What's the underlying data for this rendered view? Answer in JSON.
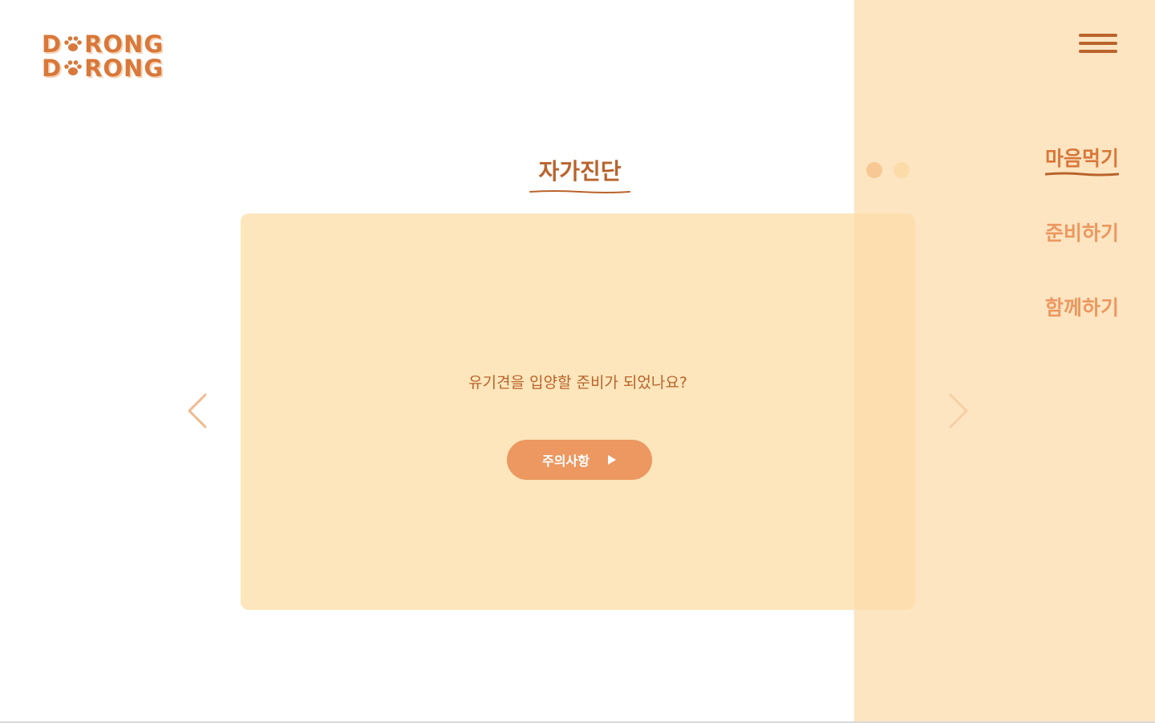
{
  "logo": {
    "line1_start": "D",
    "line1_end": "RONG",
    "line2_start": "D",
    "line2_end": "RONG",
    "icon": "paw-icon"
  },
  "page_title": "자가진단",
  "card": {
    "question": "유기견을 입양할 준비가 되었나요?",
    "button_label": "주의사항",
    "button_icon": "play-icon"
  },
  "nav": {
    "prev_icon": "chevron-left-icon",
    "next_icon": "chevron-right-icon"
  },
  "side_menu": {
    "hamburger_icon": "hamburger-icon",
    "items": [
      {
        "label": "마음먹기",
        "active": true
      },
      {
        "label": "준비하기",
        "active": false
      },
      {
        "label": "함께하기",
        "active": false
      }
    ],
    "dots": 2
  },
  "colors": {
    "brand": "#d8783a",
    "title": "#b9632c",
    "card_bg": "#fde6bb",
    "button_bg": "#ec9860",
    "menu_text": "#ec9860",
    "panel_bg": "#fcdbaa"
  }
}
